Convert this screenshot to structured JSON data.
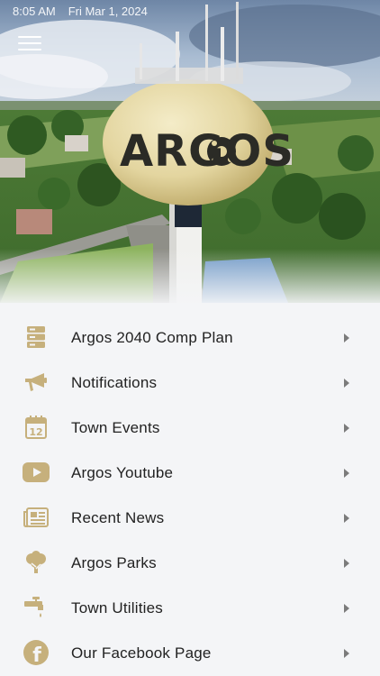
{
  "status_bar": {
    "time": "8:05 AM",
    "date": "Fri Mar 1, 2024"
  },
  "hero": {
    "tower_text": "ARGOS"
  },
  "colors": {
    "accent": "#c6b07c",
    "background": "#f4f5f7",
    "text": "#222222",
    "chevron": "#7b7b7b"
  },
  "menu": {
    "items": [
      {
        "label": "Argos 2040 Comp Plan",
        "icon": "document-stack-icon"
      },
      {
        "label": "Notifications",
        "icon": "megaphone-icon"
      },
      {
        "label": "Town Events",
        "icon": "calendar-icon"
      },
      {
        "label": "Argos Youtube",
        "icon": "youtube-icon"
      },
      {
        "label": "Recent News",
        "icon": "newspaper-icon"
      },
      {
        "label": "Argos Parks",
        "icon": "tree-icon"
      },
      {
        "label": "Town Utilities",
        "icon": "faucet-icon"
      },
      {
        "label": "Our Facebook Page",
        "icon": "facebook-icon"
      }
    ]
  },
  "icons": {
    "calendar_day": "12",
    "facebook_letter": "f"
  }
}
